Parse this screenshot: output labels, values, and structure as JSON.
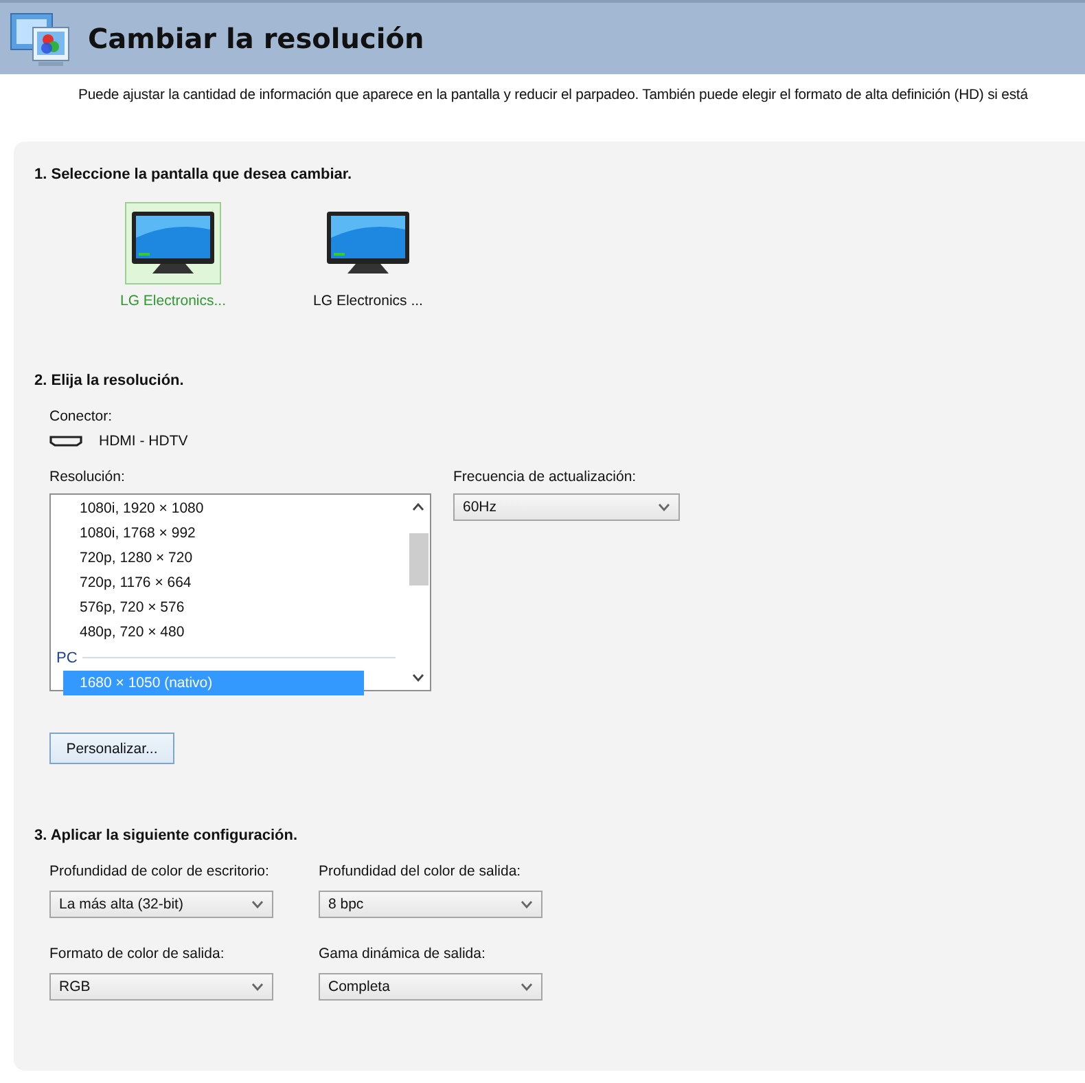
{
  "header": {
    "title": "Cambiar la resolución"
  },
  "description": "Puede ajustar la cantidad de información que aparece en la pantalla y reducir el parpadeo. También puede elegir el formato de alta definición (HD) si está",
  "step1": {
    "title": "1. Seleccione la pantalla que desea cambiar.",
    "displays": [
      {
        "label": "LG Electronics...",
        "selected": true
      },
      {
        "label": "LG Electronics ...",
        "selected": false
      }
    ]
  },
  "step2": {
    "title": "2. Elija la resolución.",
    "connector_label": "Conector:",
    "connector": "HDMI - HDTV",
    "resolution_label": "Resolución:",
    "resolutions": [
      {
        "kind": "item",
        "text": "1080i, 1920 × 1080",
        "selected": false
      },
      {
        "kind": "item",
        "text": "1080i, 1768 × 992",
        "selected": false
      },
      {
        "kind": "item",
        "text": "720p, 1280 × 720",
        "selected": false
      },
      {
        "kind": "item",
        "text": "720p, 1176 × 664",
        "selected": false
      },
      {
        "kind": "item",
        "text": "576p, 720 × 576",
        "selected": false
      },
      {
        "kind": "item",
        "text": "480p, 720 × 480",
        "selected": false
      },
      {
        "kind": "group",
        "text": "PC"
      },
      {
        "kind": "item",
        "text": "1680 × 1050 (nativo)",
        "selected": true
      }
    ],
    "refresh_label": "Frecuencia de actualización:",
    "refresh": "60Hz",
    "customize_button": "Personalizar..."
  },
  "step3": {
    "title": "3. Aplicar la siguiente configuración.",
    "settings": [
      {
        "label": "Profundidad de color de escritorio:",
        "value": "La más alta (32-bit)"
      },
      {
        "label": "Profundidad del color de salida:",
        "value": "8 bpc"
      },
      {
        "label": "Formato de color de salida:",
        "value": "RGB"
      },
      {
        "label": "Gama dinámica de salida:",
        "value": "Completa"
      }
    ]
  }
}
